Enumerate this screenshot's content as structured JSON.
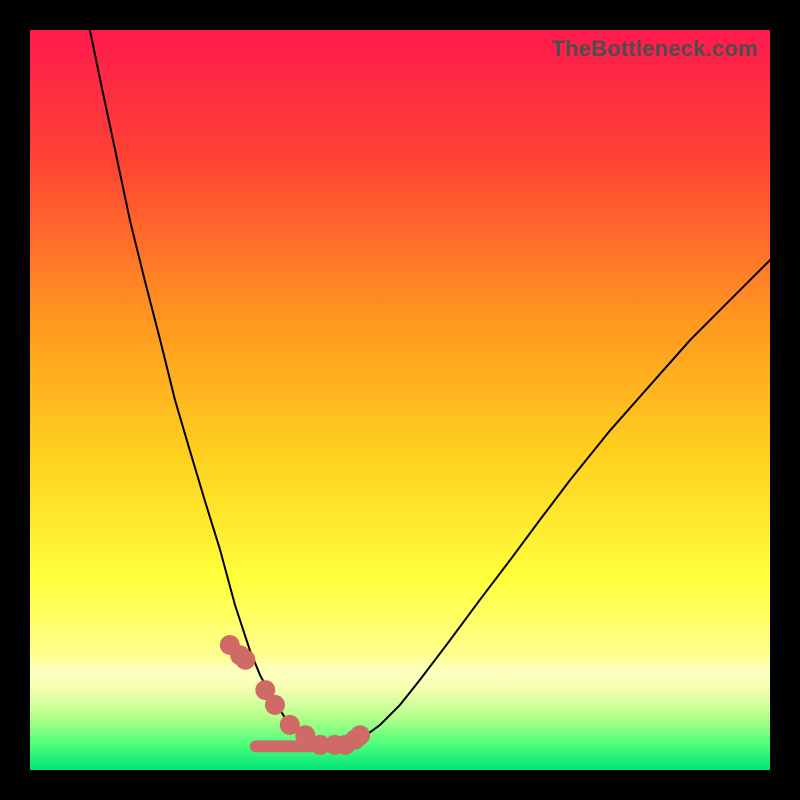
{
  "watermark": "TheBottleneck.com",
  "chart_data": {
    "type": "line",
    "title": "",
    "xlabel": "",
    "ylabel": "",
    "xlim": [
      0,
      100
    ],
    "ylim": [
      0,
      100
    ],
    "note": "Bottleneck-calculator style V-curve over a vertical traffic-light gradient. No axes, ticks, or labels are shown. Values are read from pixel positions as percentages of the plot area (0,0 bottom-left to 100,100 top-right).",
    "gradient_stops": [
      {
        "pos": 0.0,
        "color": "#ff1a4d"
      },
      {
        "pos": 0.18,
        "color": "#ff4433"
      },
      {
        "pos": 0.4,
        "color": "#ff9a1f"
      },
      {
        "pos": 0.58,
        "color": "#ffd21f"
      },
      {
        "pos": 0.74,
        "color": "#ffff3a"
      },
      {
        "pos": 0.845,
        "color": "#ffff8f"
      },
      {
        "pos": 0.865,
        "color": "#ffffc0"
      },
      {
        "pos": 0.892,
        "color": "#f2ffb0"
      },
      {
        "pos": 0.93,
        "color": "#b0ff8a"
      },
      {
        "pos": 0.965,
        "color": "#4dff7a"
      },
      {
        "pos": 1.0,
        "color": "#00e676"
      }
    ],
    "series": [
      {
        "name": "curve",
        "stroke": "#000000",
        "stroke_width": 2,
        "x": [
          8.1,
          9.5,
          11.5,
          13.5,
          15.5,
          17.6,
          19.6,
          21.6,
          23.6,
          25.7,
          27.7,
          29.7,
          31.1,
          31.8,
          32.4,
          33.8,
          35.1,
          36.5,
          39.2,
          41.9,
          43.2,
          44.6,
          47.3,
          50.0,
          52.7,
          56.8,
          60.8,
          64.9,
          68.9,
          73.0,
          78.4,
          83.8,
          89.2,
          94.6,
          100.0
        ],
        "y": [
          100.0,
          93.2,
          83.8,
          74.3,
          66.2,
          58.1,
          50.0,
          43.2,
          36.5,
          29.7,
          22.3,
          16.2,
          12.8,
          11.5,
          10.8,
          8.1,
          6.1,
          4.7,
          3.4,
          3.4,
          3.4,
          4.1,
          6.1,
          8.8,
          12.2,
          17.6,
          23.0,
          28.4,
          33.8,
          39.2,
          45.9,
          52.0,
          58.1,
          63.5,
          68.9
        ]
      }
    ],
    "markers": {
      "name": "dots",
      "color": "#cf6a66",
      "radius_pct": 1.35,
      "x": [
        27.0,
        28.4,
        29.1,
        31.8,
        33.1,
        35.1,
        37.2,
        39.2,
        41.2,
        42.6,
        43.9,
        44.6
      ],
      "y": [
        16.9,
        15.5,
        14.9,
        10.8,
        8.8,
        6.1,
        4.7,
        3.4,
        3.4,
        3.4,
        4.1,
        4.7
      ]
    },
    "baseline": {
      "name": "ground",
      "color": "#cf6a66",
      "y": 3.2,
      "height_pct": 1.6,
      "x0": 29.7,
      "x1": 43.2
    }
  }
}
